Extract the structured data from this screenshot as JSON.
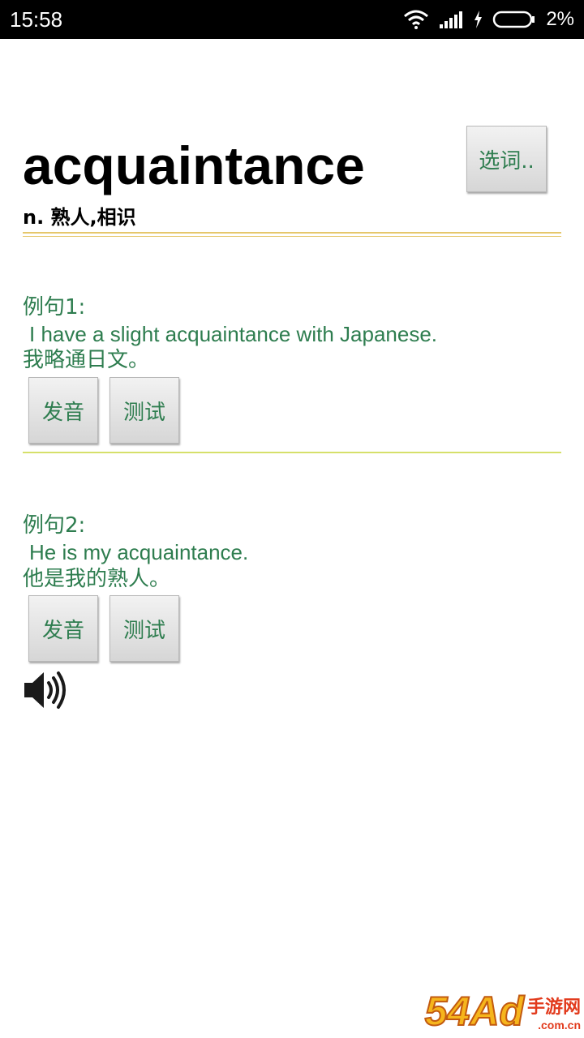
{
  "status_bar": {
    "time": "15:58",
    "battery_percent": "2%",
    "icons": [
      "wifi-icon",
      "signal-icon",
      "charging-icon",
      "battery-icon"
    ]
  },
  "header": {
    "word": "acquaintance",
    "meaning": "n. 熟人,相识",
    "select_button": "选词.."
  },
  "examples": [
    {
      "label": "例句1:",
      "english": "I have a slight acquaintance with Japanese.",
      "chinese": "我略通日文。",
      "pronounce_button": "发音",
      "test_button": "测试"
    },
    {
      "label": "例句2:",
      "english": "He is my acquaintance.",
      "chinese": "他是我的熟人。",
      "pronounce_button": "发音",
      "test_button": "测试"
    }
  ],
  "speaker_icon": "speaker-icon",
  "watermark": {
    "big": "54Ad",
    "top": "手游网",
    "bottom": ".com.cn"
  },
  "colors": {
    "accent_green": "#2e7d4f",
    "divider_gold": "#e6c76b",
    "divider_green": "#d6e06a",
    "status_bar_bg": "#000000"
  }
}
